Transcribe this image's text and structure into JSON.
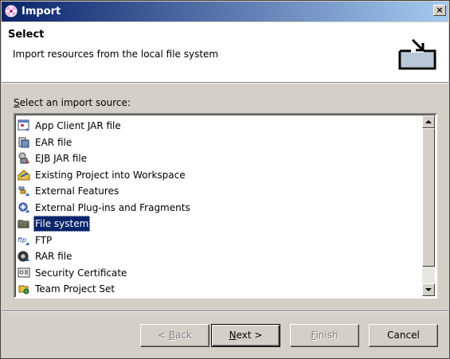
{
  "window": {
    "title": "Import",
    "close_label": "×"
  },
  "header": {
    "title": "Select",
    "description": "Import resources from the local file system"
  },
  "list": {
    "label_mnemonic": "S",
    "label_rest": "elect an import source:",
    "items": [
      {
        "label": "App Client JAR file",
        "icon": "app-client-jar-icon"
      },
      {
        "label": "EAR file",
        "icon": "ear-file-icon"
      },
      {
        "label": "EJB JAR file",
        "icon": "ejb-jar-icon"
      },
      {
        "label": "Existing Project into Workspace",
        "icon": "existing-project-icon"
      },
      {
        "label": "External Features",
        "icon": "external-features-icon"
      },
      {
        "label": "External Plug-ins and Fragments",
        "icon": "external-plugins-icon"
      },
      {
        "label": "File system",
        "icon": "folder-icon",
        "selected": true
      },
      {
        "label": "FTP",
        "icon": "ftp-icon"
      },
      {
        "label": "RAR file",
        "icon": "rar-file-icon"
      },
      {
        "label": "Security Certificate",
        "icon": "certificate-icon"
      },
      {
        "label": "Team Project Set",
        "icon": "team-project-set-icon"
      }
    ]
  },
  "buttons": {
    "back": {
      "pre": "< ",
      "mnemonic": "B",
      "rest": "ack"
    },
    "next": {
      "pre": "",
      "mnemonic": "N",
      "rest": "ext >"
    },
    "finish": {
      "pre": "",
      "mnemonic": "F",
      "rest": "inish"
    },
    "cancel": {
      "label": "Cancel"
    }
  },
  "colors": {
    "title_gradient_start": "#0a246a",
    "title_gradient_end": "#a6caf0",
    "selection": "#0a246a",
    "dialog_bg": "#d4d0c8"
  }
}
